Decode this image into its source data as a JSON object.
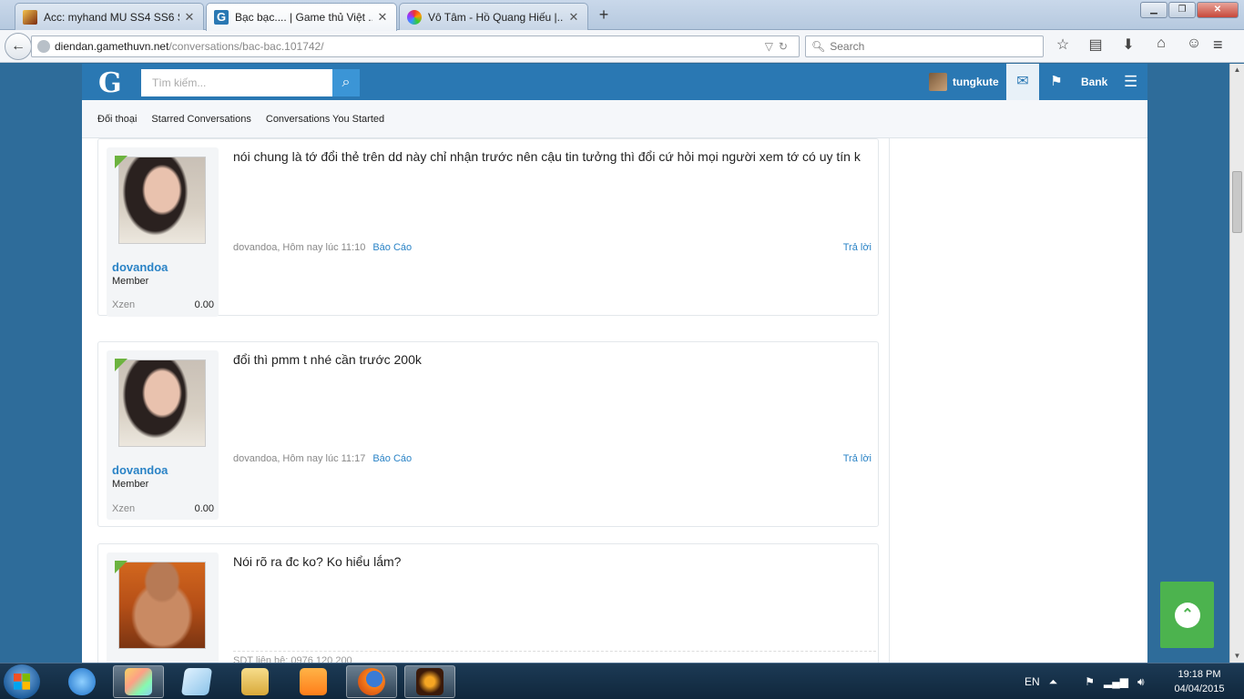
{
  "browser": {
    "tabs": [
      {
        "title": "Acc: myhand MU SS4 SS6 S...",
        "icon": "mu-favicon",
        "active": false
      },
      {
        "title": "Bạc bạc.... | Game thủ Việt ...",
        "icon": "gamethuvn-favicon",
        "active": true
      },
      {
        "title": "Vô Tâm - Hồ Quang Hiếu |...",
        "icon": "music-favicon",
        "active": false
      }
    ],
    "url_domain": "diendan.gamethuvn.net",
    "url_path": "/conversations/bac-bac.101742/",
    "search_placeholder": "Search"
  },
  "site": {
    "logo": "G",
    "search_placeholder": "Tìm kiếm...",
    "username": "tungkute",
    "bank_label": "Bank",
    "subnav": [
      "Đối thoại",
      "Starred Conversations",
      "Conversations You Started"
    ]
  },
  "messages": [
    {
      "username": "dovandoa",
      "role": "Member",
      "stat_label": "Xzen",
      "stat_value": "0.00",
      "text": "nói chung là tớ đổi thẻ trên dd này chỉ nhận trước nên cậu tin tưởng thì đổi cứ hỏi mọi người xem tớ có uy tín k",
      "meta": "dovandoa, Hôm nay lúc 11:10",
      "report": "Báo Cáo",
      "reply": "Trả lời"
    },
    {
      "username": "dovandoa",
      "role": "Member",
      "stat_label": "Xzen",
      "stat_value": "0.00",
      "text": "đổi thì pmm t nhé cần trước 200k",
      "meta": "dovandoa, Hôm nay lúc 11:17",
      "report": "Báo Cáo",
      "reply": "Trả lời"
    },
    {
      "text": "Nói rõ ra đc ko? Ko hiểu lắm?",
      "signature": "SDT liên hệ: 0976 120 200"
    }
  ],
  "taskbar": {
    "language": "EN",
    "time": "19:18 PM",
    "date": "04/04/2015"
  },
  "colors": {
    "site_header": "#2a78b3",
    "link": "#2a83c6",
    "back_to_top": "#4cb34e"
  }
}
